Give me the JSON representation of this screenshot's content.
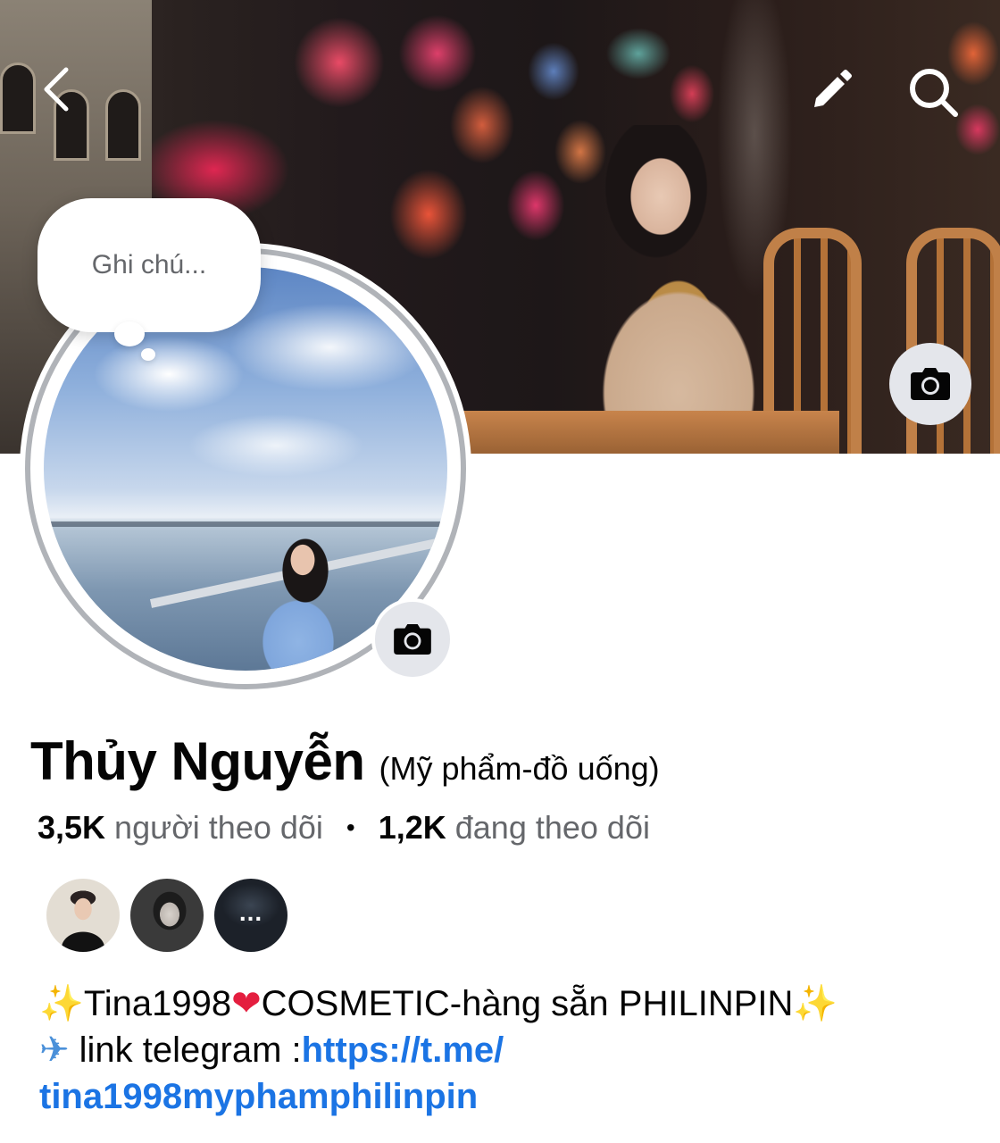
{
  "profile": {
    "name": "Thủy Nguyễn",
    "subtitle": "(Mỹ phẩm-đồ uống)",
    "note_placeholder": "Ghi chú...",
    "followers_count": "3,5K",
    "followers_label": "người theo dõi",
    "separator": "•",
    "following_count": "1,2K",
    "following_label": "đang theo dõi"
  },
  "mutual_friends": {
    "more_label": "..."
  },
  "bio": {
    "line1_sparkle_start": "✨",
    "line1_part1": "Tina1998",
    "line1_heart": "❤",
    "line1_part2": "COSMETIC-hàng sẵn PHILINPIN",
    "line1_sparkle_end": "✨",
    "line2_plane": "✈",
    "line2_text": " link telegram :",
    "link_part1": "https://t.me/",
    "link_part2": "tina1998myphamphilinpin"
  },
  "icons": {
    "back": "chevron-left-icon",
    "edit": "pencil-icon",
    "search": "search-icon",
    "camera": "camera-icon"
  },
  "colors": {
    "link": "#1b74e4",
    "secondary_text": "#65676b",
    "camera_button_bg": "#e4e6eb"
  }
}
